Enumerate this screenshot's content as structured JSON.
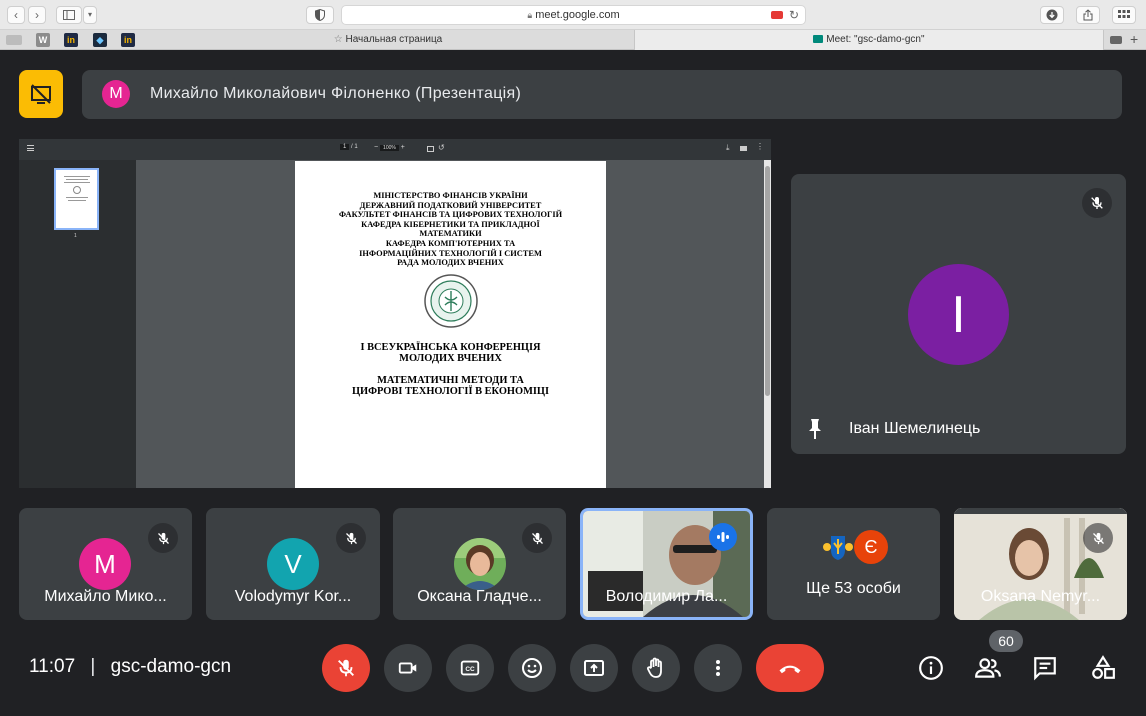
{
  "browser": {
    "address": "meet.google.com",
    "tabs": [
      {
        "label": "Начальная страница"
      },
      {
        "label": "Meet: \"gsc-damo-gcn\""
      }
    ],
    "bookmarks": [
      {
        "icon": "wordpress-icon",
        "glyph": "W"
      },
      {
        "icon": "in-icon",
        "glyph": "in"
      },
      {
        "icon": "codepen-icon",
        "glyph": "◆"
      },
      {
        "icon": "in-icon",
        "glyph": "in"
      }
    ]
  },
  "presentation": {
    "avatar_letter": "M",
    "presenter": "Михайло Миколайович Філоненко (Презентація)"
  },
  "pdf": {
    "page_current": "1",
    "page_sep": "/",
    "page_total": "1",
    "zoom": "100%",
    "thumb_label": "1",
    "doc": {
      "header_lines": [
        "МІНІСТЕРСТВО ФІНАНСІВ УКРАЇНИ",
        "ДЕРЖАВНИЙ ПОДАТКОВИЙ УНІВЕРСИТЕТ",
        "ФАКУЛЬТЕТ ФІНАНСІВ ТА ЦИФРОВИХ ТЕХНОЛОГІЙ",
        "КАФЕДРА КІБЕРНЕТИКИ ТА ПРИКЛАДНОЇ",
        "МАТЕМАТИКИ",
        "КАФЕДРА КОМП'ЮТЕРНИХ ТА",
        "ІНФОРМАЦІЙНИХ ТЕХНОЛОГІЙ І СИСТЕМ",
        "РАДА МОЛОДИХ ВЧЕНИХ"
      ],
      "conf_line1": "І ВСЕУКРАЇНСЬКА КОНФЕРЕНЦІЯ",
      "conf_line2": "МОЛОДИХ ВЧЕНИХ",
      "topic_line1": "МАТЕМАТИЧНІ МЕТОДИ ТА",
      "topic_line2": "ЦИФРОВІ ТЕХНОЛОГІЇ В ЕКОНОМІЦІ"
    }
  },
  "pinned": {
    "letter": "I",
    "name": "Іван Шемелинець",
    "color": "#7b1fa2"
  },
  "participants": [
    {
      "name": "Михайло Мико...",
      "letter": "M",
      "color": "#e52592"
    },
    {
      "name": "Volodymyr Kor...",
      "letter": "V",
      "color": "#12a4af"
    },
    {
      "name": "Оксана Гладче..."
    },
    {
      "name": "Володимир Ла..."
    },
    {
      "name": "Ще 53 особи",
      "letter": "Є",
      "color": "#e8430a"
    },
    {
      "name": "Oksana Nemyr..."
    }
  ],
  "footer": {
    "time": "11:07",
    "separator": "|",
    "meeting_code": "gsc-damo-gcn",
    "people_count": "60"
  },
  "colors": {
    "accent_blue": "#8ab4f8",
    "end_call_red": "#ea4335",
    "presenting_yellow": "#fbbc04"
  }
}
